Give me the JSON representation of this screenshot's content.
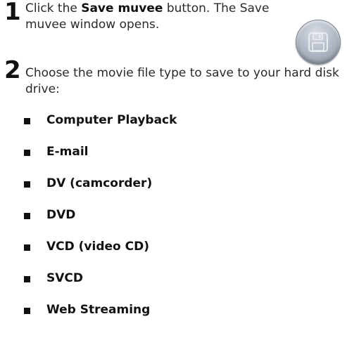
{
  "steps": [
    {
      "number": "1",
      "text_before": "Click the ",
      "text_bold": "Save muvee",
      "text_after": " button. The Save muvee window opens."
    },
    {
      "number": "2",
      "text": "Choose the movie file type to save to your hard disk drive:"
    }
  ],
  "save_button": {
    "icon": "floppy-disk-icon",
    "color": "#b4bcc8"
  },
  "options": [
    "Computer Playback",
    "E-mail",
    "DV (camcorder)",
    "DVD",
    "VCD (video CD)",
    "SVCD",
    "Web Streaming"
  ]
}
